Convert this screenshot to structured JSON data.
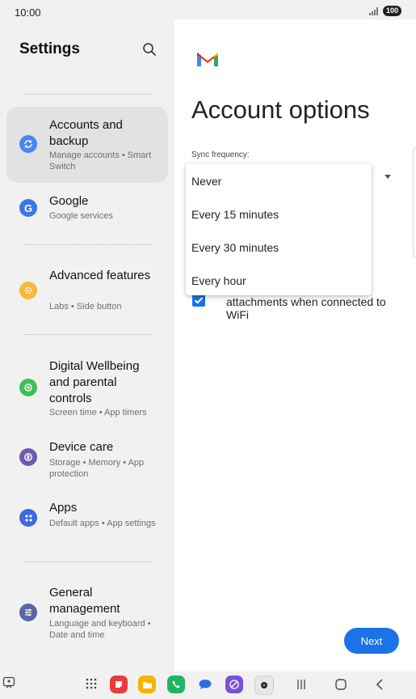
{
  "status_bar": {
    "time": "10:00",
    "battery": "100"
  },
  "sidebar": {
    "title": "Settings",
    "items": [
      {
        "title": "Accounts and backup",
        "subtitle": "Manage accounts • Smart Switch",
        "icon": "sync-icon",
        "color": "#4c85f3",
        "selected": true
      },
      {
        "title": "Google",
        "subtitle": "Google services",
        "icon": "google-icon",
        "color": "#3b78e7"
      },
      {
        "title": "Advanced features",
        "subtitle": "Labs • Side button",
        "icon": "gear-plus-icon",
        "color": "#f6b93b"
      },
      {
        "title": "Digital Wellbeing and parental controls",
        "subtitle": "Screen time • App timers",
        "icon": "wellbeing-icon",
        "color": "#3fbf57"
      },
      {
        "title": "Device care",
        "subtitle": "Storage • Memory • App protection",
        "icon": "device-care-icon",
        "color": "#6e5aa8"
      },
      {
        "title": "Apps",
        "subtitle": "Default apps • App settings",
        "icon": "apps-icon",
        "color": "#3f67e0"
      },
      {
        "title": "General management",
        "subtitle": "Language and keyboard • Date and time",
        "icon": "sliders-icon",
        "color": "#5866a8"
      }
    ]
  },
  "content": {
    "title": "Account options",
    "sync_label": "Sync frequency:",
    "dropdown_options": [
      "Never",
      "Every 15 minutes",
      "Every 30 minutes",
      "Every hour"
    ],
    "checkbox_text": "attachments when connected to WiFi",
    "checkbox_checked": true,
    "next_label": "Next",
    "accent": "#1a73e8"
  },
  "taskbar": {
    "apps": [
      "app-drawer-icon",
      "notes-app-icon",
      "my-files-icon",
      "phone-app-icon",
      "messages-app-icon",
      "internet-app-icon",
      "camera-app-icon"
    ]
  }
}
